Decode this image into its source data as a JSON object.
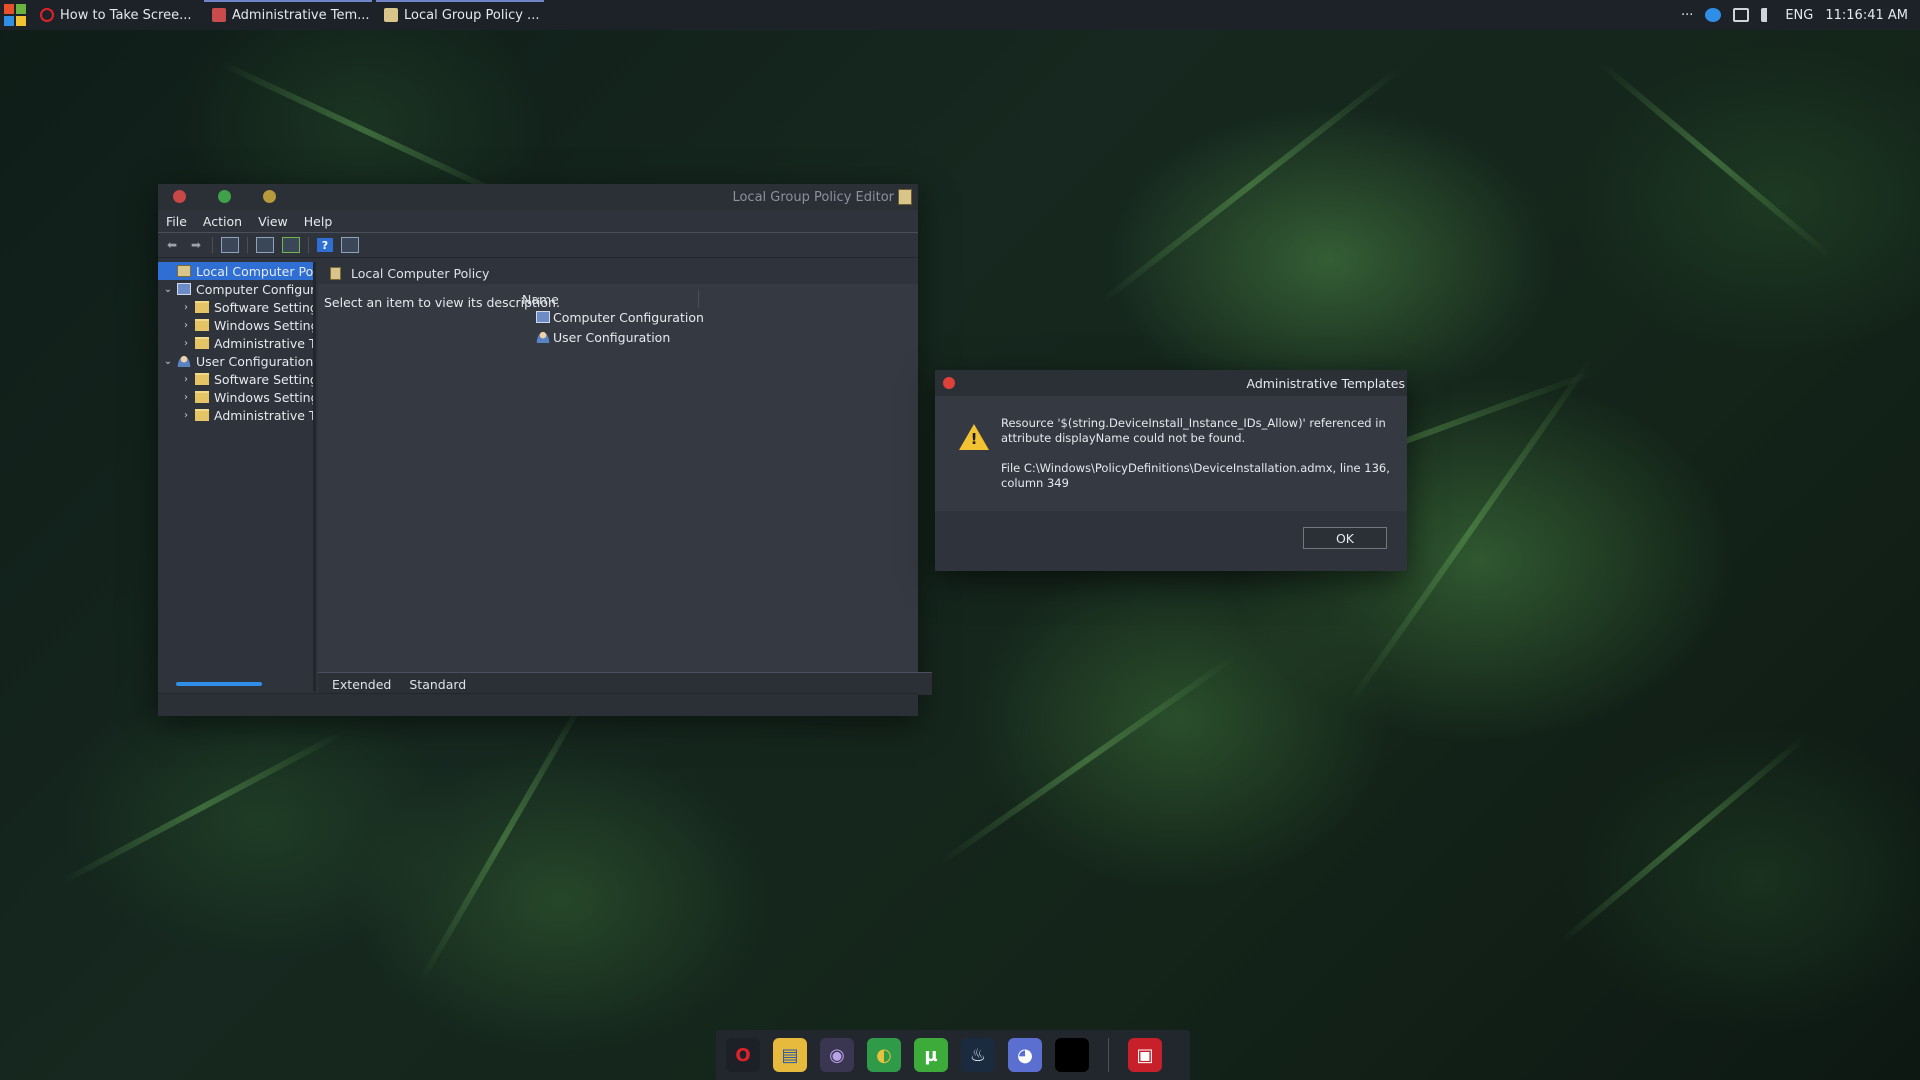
{
  "taskbar": {
    "tabs": [
      {
        "label": "How to Take Scree...",
        "icon": "opera-icon",
        "color": "#e0232a"
      },
      {
        "label": "Administrative Tem...",
        "icon": "admin-templates-icon",
        "color": "#c94b4b"
      },
      {
        "label": "Local Group Policy ...",
        "icon": "policy-icon",
        "color": "#d9c58a"
      }
    ],
    "tray": {
      "overflow": "···",
      "language": "ENG",
      "time": "11:16:41 AM"
    }
  },
  "window": {
    "title": "Local Group Policy Editor",
    "menu": [
      "File",
      "Action",
      "View",
      "Help"
    ],
    "tree": [
      {
        "label": "Local Computer Policy",
        "chev": "",
        "indent": 0,
        "icon": "policy",
        "selected": true
      },
      {
        "label": "Computer Configuration",
        "chev": "⌄",
        "indent": 0,
        "icon": "computer"
      },
      {
        "label": "Software Settings",
        "chev": "›",
        "indent": 1,
        "icon": "folder"
      },
      {
        "label": "Windows Settings",
        "chev": "›",
        "indent": 1,
        "icon": "folder"
      },
      {
        "label": "Administrative Templates",
        "chev": "›",
        "indent": 1,
        "icon": "folder"
      },
      {
        "label": "User Configuration",
        "chev": "⌄",
        "indent": 0,
        "icon": "user"
      },
      {
        "label": "Software Settings",
        "chev": "›",
        "indent": 1,
        "icon": "folder"
      },
      {
        "label": "Windows Settings",
        "chev": "›",
        "indent": 1,
        "icon": "folder"
      },
      {
        "label": "Administrative Templates",
        "chev": "›",
        "indent": 1,
        "icon": "folder"
      }
    ],
    "content": {
      "heading": "Local Computer Policy",
      "description": "Select an item to view its description.",
      "column_name": "Name",
      "items": [
        {
          "label": "Computer Configuration",
          "icon": "computer"
        },
        {
          "label": "User Configuration",
          "icon": "user"
        }
      ]
    },
    "bottom_tabs": [
      "Extended",
      "Standard"
    ]
  },
  "dialog": {
    "title": "Administrative Templates",
    "message_line1": "Resource '$(string.DeviceInstall_Instance_IDs_Allow)' referenced in attribute displayName could not be found.",
    "message_line2": "File C:\\Windows\\PolicyDefinitions\\DeviceInstallation.admx, line 136, column 349",
    "ok_label": "OK"
  },
  "dock": [
    {
      "name": "opera-icon",
      "glyph": "O",
      "color": "#1d2026",
      "fg": "#e0232a"
    },
    {
      "name": "file-explorer-icon",
      "glyph": "▤",
      "color": "#e7b93c",
      "fg": "#2a5da8"
    },
    {
      "name": "tor-browser-icon",
      "glyph": "◉",
      "color": "#3a3550",
      "fg": "#b9a3e8"
    },
    {
      "name": "chromium-icon",
      "glyph": "◐",
      "color": "#2f9a48",
      "fg": "#e8c23a"
    },
    {
      "name": "utorrent-icon",
      "glyph": "µ",
      "color": "#3cab3a",
      "fg": "#ffffff"
    },
    {
      "name": "steam-icon",
      "glyph": "♨",
      "color": "#1a2a3f",
      "fg": "#d8e3f0"
    },
    {
      "name": "discord-icon",
      "glyph": "◕",
      "color": "#5b6fd1",
      "fg": "#ffffff"
    },
    {
      "name": "terminal-icon",
      "glyph": "",
      "color": "#000000",
      "fg": "#ffffff"
    },
    {
      "name": "app-store-icon",
      "glyph": "▣",
      "color": "#c8202a",
      "fg": "#ffffff"
    }
  ],
  "colors": {
    "accent": "#2f6fd3",
    "close_dot": "#c84848",
    "min_dot": "#3fa14a",
    "max_dot": "#b79a3b",
    "warning": "#f2c230"
  }
}
